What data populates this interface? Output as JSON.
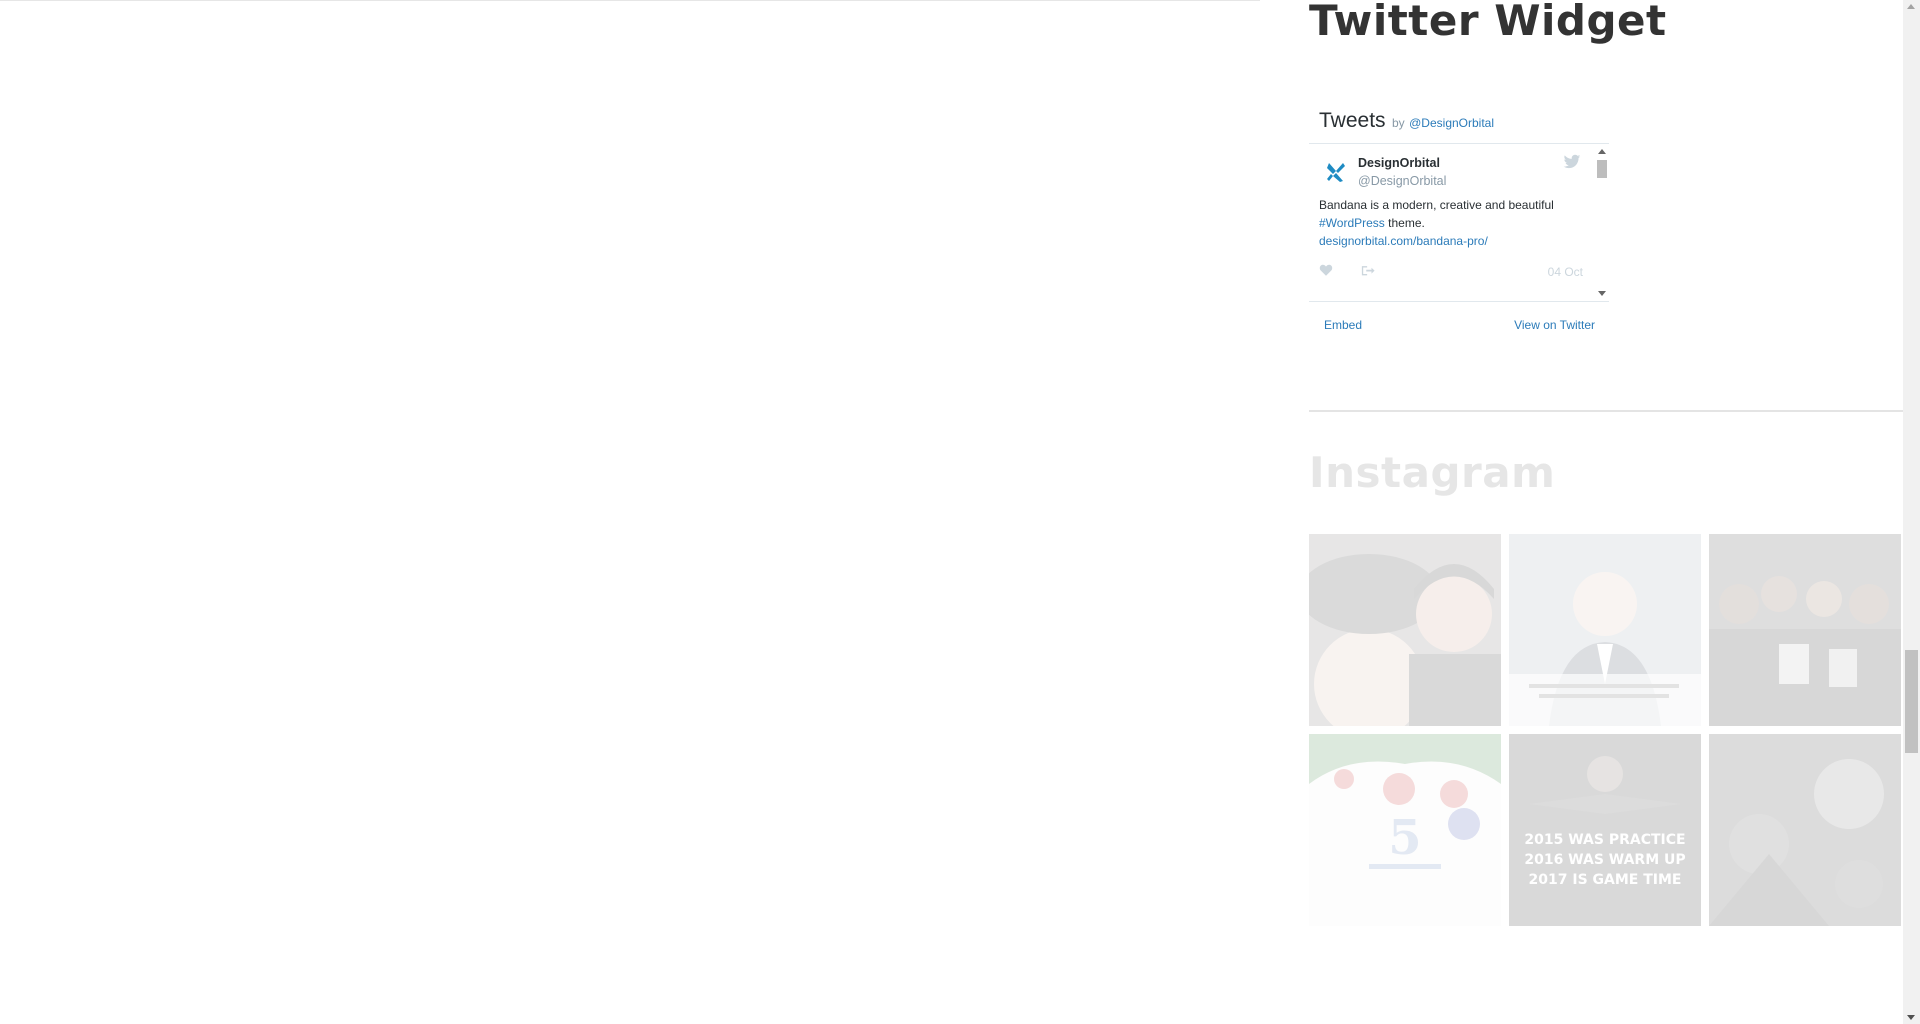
{
  "twitter_widget": {
    "title": "Twitter Widget",
    "header_tweets": "Tweets",
    "header_by": "by",
    "header_handle": "@DesignOrbital",
    "tweet": {
      "name": "DesignOrbital",
      "handle": "@DesignOrbital",
      "text_part1": "Bandana is a modern, creative and beautiful",
      "hashtag": "#WordPress",
      "text_part2": "theme.",
      "link": "designorbital.com/bandana-pro/",
      "date": "04 Oct"
    },
    "footer_embed": "Embed",
    "footer_view": "View on Twitter",
    "accent_color": "#2b7bb9"
  },
  "instagram": {
    "title": "Instagram",
    "items": [
      {
        "icon": "instagram-photo-selfie",
        "text": ""
      },
      {
        "icon": "instagram-photo-portrait",
        "text": ""
      },
      {
        "icon": "instagram-photo-group",
        "text": ""
      },
      {
        "icon": "instagram-photo-christmas",
        "text": "5"
      },
      {
        "icon": "instagram-photo-motivational",
        "text": "2015 WAS PRACTICE 2016 WAS WARM UP 2017 IS GAME TIME"
      },
      {
        "icon": "instagram-photo-event",
        "text": ""
      }
    ]
  }
}
